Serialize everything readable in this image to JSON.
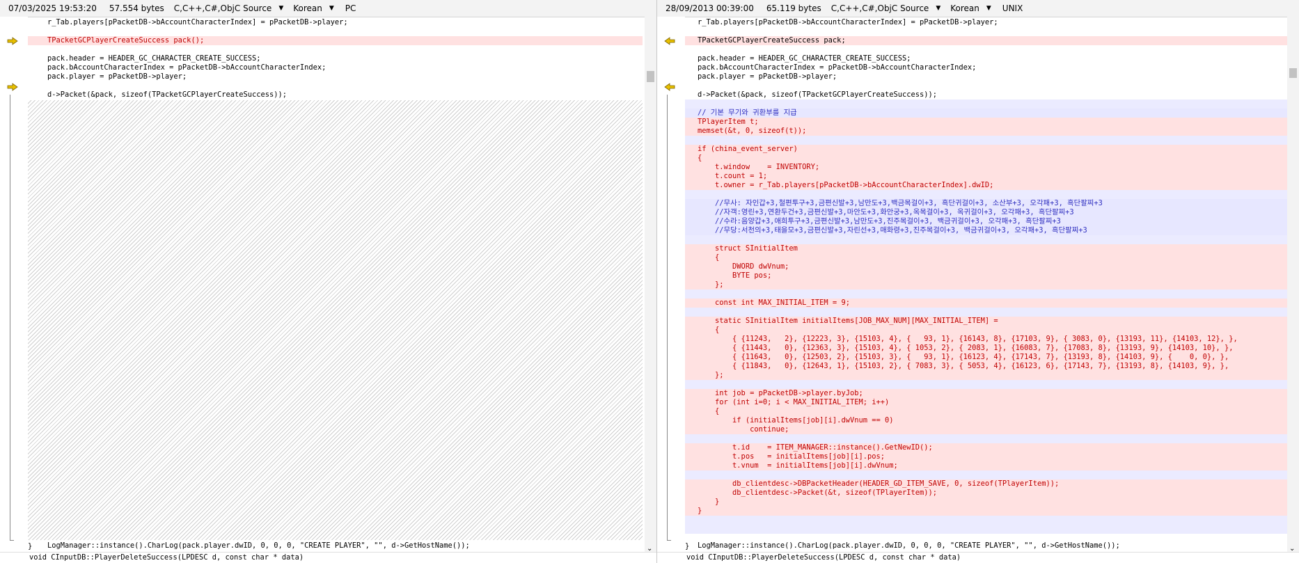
{
  "left": {
    "date": "07/03/2025 19:53:20",
    "size": "57.554 bytes",
    "language": "C,C++,C#,ObjC Source",
    "encoding": "Korean",
    "line_ending": "PC",
    "lines": [
      "r_Tab.players[pPacketDB->bAccountCharacterIndex] = pPacketDB->player;",
      "",
      "TPacketGCPlayerCreateSuccess pack();",
      "",
      "pack.header = HEADER_GC_CHARACTER_CREATE_SUCCESS;",
      "pack.bAccountCharacterIndex = pPacketDB->bAccountCharacterIndex;",
      "pack.player = pPacketDB->player;",
      "",
      "d->Packet(&pack, sizeof(TPacketGCPlayerCreateSuccess));"
    ],
    "log_line": "LogManager::instance().CharLog(pack.player.dwID, 0, 0, 0, \"CREATE PLAYER\", \"\", d->GetHostName());",
    "close_brace": "}",
    "footer": "void CInputDB::PlayerDeleteSuccess(LPDESC d, const char * data)"
  },
  "right": {
    "date": "28/09/2013 00:39:00",
    "size": "65.119 bytes",
    "language": "C,C++,C#,ObjC Source",
    "encoding": "Korean",
    "line_ending": "UNIX",
    "lines": [
      "r_Tab.players[pPacketDB->bAccountCharacterIndex] = pPacketDB->player;",
      "",
      "TPacketGCPlayerCreateSuccess pack;",
      "",
      "pack.header = HEADER_GC_CHARACTER_CREATE_SUCCESS;",
      "pack.bAccountCharacterIndex = pPacketDB->bAccountCharacterIndex;",
      "pack.player = pPacketDB->player;",
      "",
      "d->Packet(&pack, sizeof(TPacketGCPlayerCreateSuccess));",
      "",
      "// 기본 무기와 귀환부를 지급",
      "TPlayerItem t;",
      "memset(&t, 0, sizeof(t));",
      "",
      "if (china_event_server)",
      "{",
      "    t.window    = INVENTORY;",
      "    t.count = 1;",
      "    t.owner = r_Tab.players[pPacketDB->bAccountCharacterIndex].dwID;",
      "",
      "    //무사: 자인갑+3,철편투구+3,금편신발+3,남만도+3,백금목걸이+3, 흑단귀걸이+3, 소산부+3, 오각패+3, 흑단팔찌+3",
      "    //자객:영린+3,연환두건+3,금편신발+3,마안도+3,화안궁+3,옥목걸이+3, 옥귀걸이+3, 오각패+3, 흑단팔찌+3",
      "    //수라:음양갑+3,애희투구+3,금편신발+3,남만도+3,진주목걸이+3, 백금귀걸이+3, 오각패+3, 흑단팔찌+3",
      "    //무당:서천의+3,태을모+3,금편신발+3,자린선+3,매화령+3,진주목걸이+3, 백금귀걸이+3, 오각패+3, 흑단팔찌+3",
      "",
      "    struct SInitialItem",
      "    {",
      "        DWORD dwVnum;",
      "        BYTE pos;",
      "    };",
      "",
      "    const int MAX_INITIAL_ITEM = 9;",
      "",
      "    static SInitialItem initialItems[JOB_MAX_NUM][MAX_INITIAL_ITEM] =",
      "    {",
      "        { {11243,   2}, {12223, 3}, {15103, 4}, {   93, 1}, {16143, 8}, {17103, 9}, { 3083, 0}, {13193, 11}, {14103, 12}, },",
      "        { {11443,   0}, {12363, 3}, {15103, 4}, { 1053, 2}, { 2083, 1}, {16083, 7}, {17083, 8}, {13193, 9}, {14103, 10}, },",
      "        { {11643,   0}, {12503, 2}, {15103, 3}, {   93, 1}, {16123, 4}, {17143, 7}, {13193, 8}, {14103, 9}, {    0, 0}, },",
      "        { {11843,   0}, {12643, 1}, {15103, 2}, { 7083, 3}, { 5053, 4}, {16123, 6}, {17143, 7}, {13193, 8}, {14103, 9}, },",
      "    };",
      "",
      "    int job = pPacketDB->player.byJob;",
      "    for (int i=0; i < MAX_INITIAL_ITEM; i++)",
      "    {",
      "        if (initialItems[job][i].dwVnum == 0)",
      "            continue;",
      "",
      "        t.id    = ITEM_MANAGER::instance().GetNewID();",
      "        t.pos   = initialItems[job][i].pos;",
      "        t.vnum  = initialItems[job][i].dwVnum;",
      "",
      "        db_clientdesc->DBPacketHeader(HEADER_GD_ITEM_SAVE, 0, sizeof(TPlayerItem));",
      "        db_clientdesc->Packet(&t, sizeof(TPlayerItem));",
      "    }",
      "}",
      ""
    ],
    "log_line": "LogManager::instance().CharLog(pack.player.dwID, 0, 0, 0, \"CREATE PLAYER\", \"\", d->GetHostName());",
    "close_brace": "}",
    "footer": "void CInputDB::PlayerDeleteSuccess(LPDESC d, const char * data)"
  },
  "icons": {
    "diff_arrow_left": "arrow-right-icon",
    "diff_arrow_right": "arrow-left-icon",
    "dropdown": "triangle-down-icon",
    "scroll_down": "chevron-down-icon"
  },
  "colors": {
    "changed_bg": "#ffe1e1",
    "changed_text": "#c00000",
    "comment_bg": "#e7e7ff",
    "arrow_fill": "#e8c000"
  }
}
